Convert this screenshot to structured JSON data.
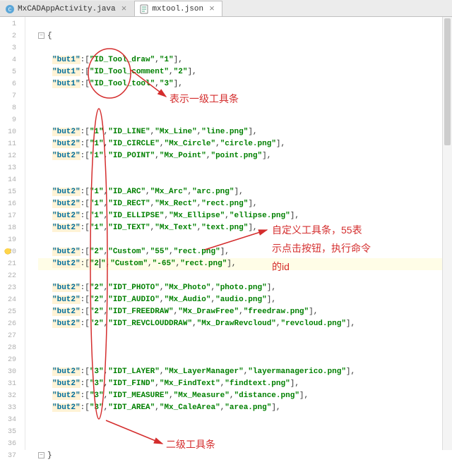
{
  "tabs": [
    {
      "label": "MxCADAppActivity.java",
      "active": false,
      "icon": "java"
    },
    {
      "label": "mxtool.json",
      "active": true,
      "icon": "json"
    }
  ],
  "annotations": {
    "top": "表示一级工具条",
    "right_l1": "自定义工具条，55表",
    "right_l2": "示点击按钮，执行命令",
    "right_l3": "的id",
    "bottom": "二级工具条"
  },
  "code": [
    {
      "n": 1,
      "raw": ""
    },
    {
      "n": 2,
      "raw": "OPEN"
    },
    {
      "n": 3,
      "raw": ""
    },
    {
      "n": 4,
      "key": "but1",
      "parts": [
        "ID_Tool_draw",
        "1"
      ]
    },
    {
      "n": 5,
      "key": "but1",
      "parts": [
        "ID_Tool_comment",
        "2"
      ]
    },
    {
      "n": 6,
      "key": "but1",
      "parts": [
        "ID_Tool_tool",
        "3"
      ]
    },
    {
      "n": 7,
      "raw": ""
    },
    {
      "n": 8,
      "raw": ""
    },
    {
      "n": 9,
      "raw": ""
    },
    {
      "n": 10,
      "key": "but2",
      "parts": [
        "1",
        "ID_LINE",
        "Mx_Line",
        "line.png"
      ]
    },
    {
      "n": 11,
      "key": "but2",
      "parts": [
        "1",
        "ID_CIRCLE",
        "Mx_Circle",
        "circle.png"
      ]
    },
    {
      "n": 12,
      "key": "but2",
      "parts": [
        "1",
        "ID_POINT",
        "Mx_Point",
        "point.png"
      ]
    },
    {
      "n": 13,
      "raw": ""
    },
    {
      "n": 14,
      "raw": ""
    },
    {
      "n": 15,
      "key": "but2",
      "parts": [
        "1",
        "ID_ARC",
        "Mx_Arc",
        "arc.png"
      ]
    },
    {
      "n": 16,
      "key": "but2",
      "parts": [
        "1",
        "ID_RECT",
        "Mx_Rect",
        "rect.png"
      ]
    },
    {
      "n": 17,
      "key": "but2",
      "parts": [
        "1",
        "ID_ELLIPSE",
        "Mx_Ellipse",
        "ellipse.png"
      ]
    },
    {
      "n": 18,
      "key": "but2",
      "parts": [
        "1",
        "ID_TEXT",
        "Mx_Text",
        "text.png"
      ]
    },
    {
      "n": 19,
      "raw": ""
    },
    {
      "n": 20,
      "key": "but2",
      "parts": [
        "2",
        "Custom",
        "55",
        "rect.png"
      ],
      "bulb": true
    },
    {
      "n": 21,
      "key": "but2",
      "caretAfterFirst": true,
      "parts": [
        "2",
        "Custom",
        "-65",
        "rect.png"
      ],
      "hl": true
    },
    {
      "n": 22,
      "raw": ""
    },
    {
      "n": 23,
      "key": "but2",
      "parts": [
        "2",
        "IDT_PHOTO",
        "Mx_Photo",
        "photo.png"
      ]
    },
    {
      "n": 24,
      "key": "but2",
      "parts": [
        "2",
        "IDT_AUDIO",
        "Mx_Audio",
        "audio.png"
      ]
    },
    {
      "n": 25,
      "key": "but2",
      "parts": [
        "2",
        "IDT_FREEDRAW",
        "Mx_DrawFree",
        "freedraw.png"
      ]
    },
    {
      "n": 26,
      "key": "but2",
      "parts": [
        "2",
        "IDT_REVCLOUDDRAW",
        "Mx_DrawRevcloud",
        "revcloud.png"
      ]
    },
    {
      "n": 27,
      "raw": ""
    },
    {
      "n": 28,
      "raw": ""
    },
    {
      "n": 29,
      "raw": ""
    },
    {
      "n": 30,
      "key": "but2",
      "parts": [
        "3",
        "IDT_LAYER",
        "Mx_LayerManager",
        "layermanagerico.png"
      ]
    },
    {
      "n": 31,
      "key": "but2",
      "parts": [
        "3",
        "IDT_FIND",
        "Mx_FindText",
        "findtext.png"
      ]
    },
    {
      "n": 32,
      "key": "but2",
      "parts": [
        "3",
        "IDT_MEASURE",
        "Mx_Measure",
        "distance.png"
      ]
    },
    {
      "n": 33,
      "key": "but2",
      "parts": [
        "3",
        "IDT_AREA",
        "Mx_CaleArea",
        "area.png"
      ]
    },
    {
      "n": 34,
      "raw": ""
    },
    {
      "n": 35,
      "raw": ""
    },
    {
      "n": 36,
      "raw": ""
    },
    {
      "n": 37,
      "raw": "CLOSE"
    }
  ]
}
